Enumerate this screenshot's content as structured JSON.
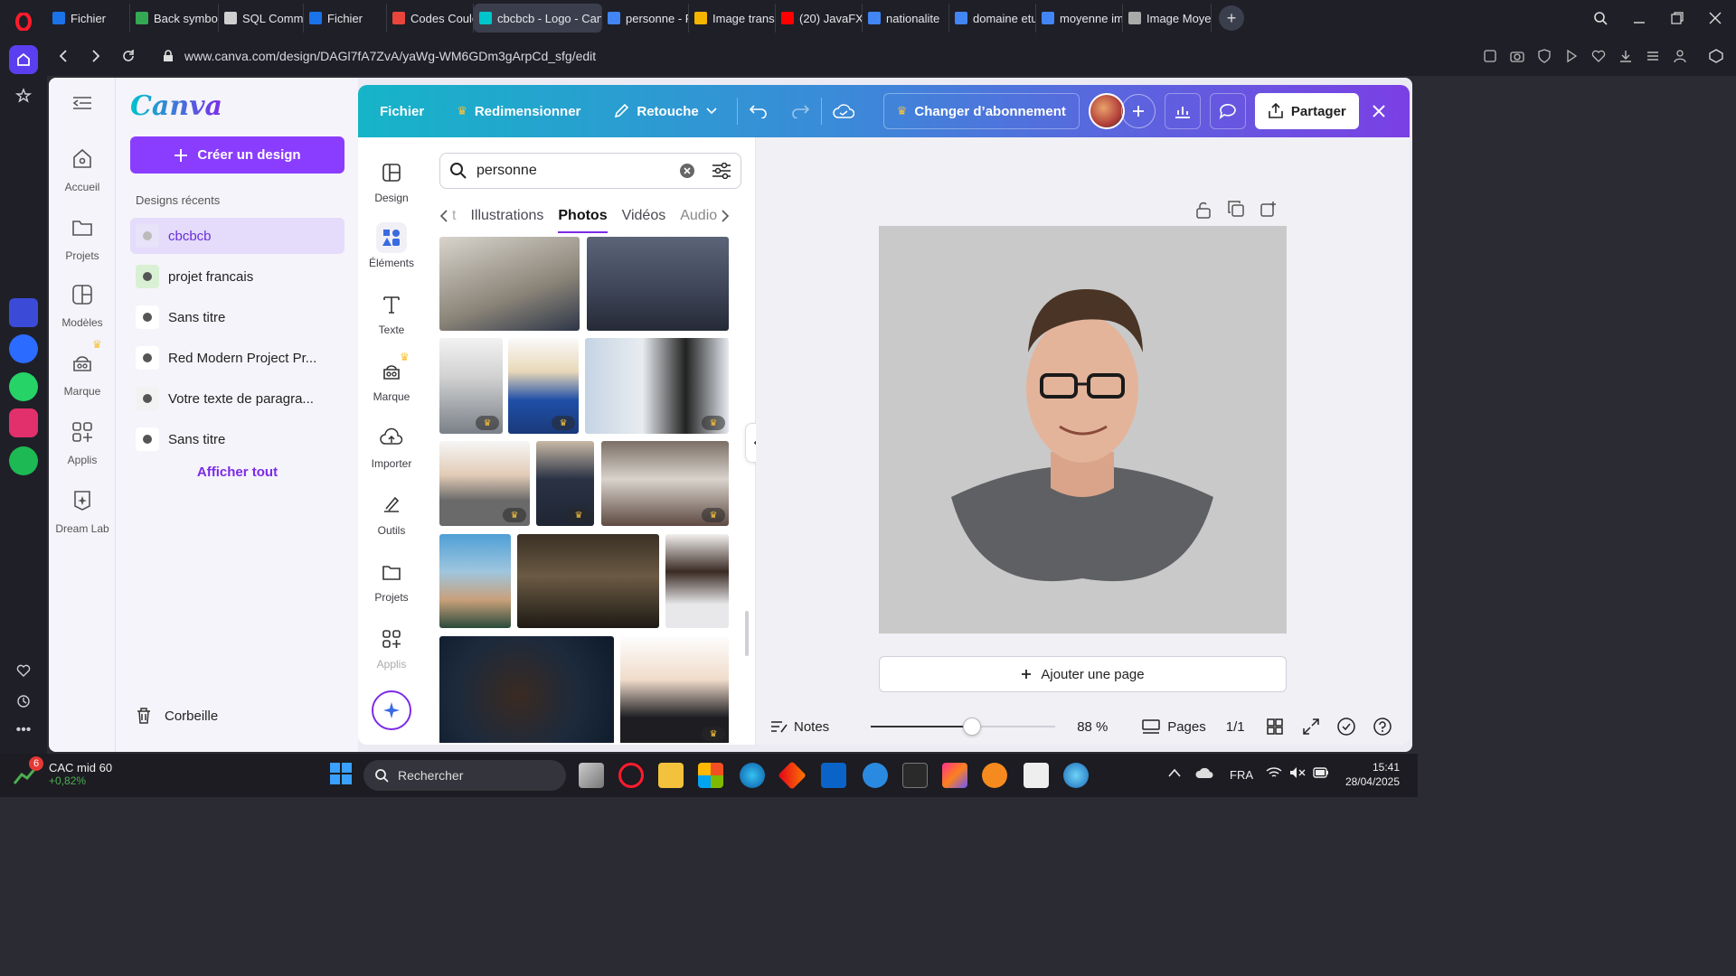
{
  "browser": {
    "tabs": [
      {
        "label": "Fichier",
        "color": "#1a73e8"
      },
      {
        "label": "Back symbo",
        "color": "#34a853"
      },
      {
        "label": "SQL Comma",
        "color": "#cfcfcf"
      },
      {
        "label": "Fichier",
        "color": "#1a73e8"
      },
      {
        "label": "Codes Coule",
        "color": "#e8453c"
      },
      {
        "label": "cbcbcb - Logo - Canv",
        "color": "#00c4cc",
        "active": true
      },
      {
        "label": "personne - F",
        "color": "#4285f4"
      },
      {
        "label": "Image transp",
        "color": "#f4b400"
      },
      {
        "label": "(20) JavaFX",
        "color": "#ff0000"
      },
      {
        "label": "nationalite",
        "color": "#4285f4"
      },
      {
        "label": "domaine etu",
        "color": "#4285f4"
      },
      {
        "label": "moyenne im",
        "color": "#4285f4"
      },
      {
        "label": "Image Moye",
        "color": "#aaaaaa"
      }
    ],
    "url": "www.canva.com/design/DAGl7fA7ZvA/yaWg-WM6GDm3gArpCd_sfg/edit"
  },
  "canva": {
    "rail": [
      {
        "label": "Accueil",
        "icon": "home-icon"
      },
      {
        "label": "Projets",
        "icon": "folder-icon"
      },
      {
        "label": "Modèles",
        "icon": "template-icon"
      },
      {
        "label": "Marque",
        "icon": "brand-icon"
      },
      {
        "label": "Applis",
        "icon": "apps-icon"
      },
      {
        "label": "Dream Lab",
        "icon": "dreamlab-icon"
      }
    ],
    "logo": "Canva",
    "create_label": "Créer un design",
    "recent_title": "Designs récents",
    "recent": [
      {
        "label": "cbcbcb"
      },
      {
        "label": "projet francais"
      },
      {
        "label": "Sans titre"
      },
      {
        "label": "Red Modern Project Pr..."
      },
      {
        "label": "Votre texte de paragra..."
      },
      {
        "label": "Sans titre"
      }
    ],
    "see_all": "Afficher tout",
    "trash": "Corbeille"
  },
  "editor": {
    "topbar": {
      "file": "Fichier",
      "resize": "Redimensionner",
      "retouch": "Retouche",
      "upgrade": "Changer d’abonnement",
      "share": "Partager"
    },
    "obj_rail": [
      {
        "label": "Design"
      },
      {
        "label": "Éléments"
      },
      {
        "label": "Texte"
      },
      {
        "label": "Marque"
      },
      {
        "label": "Importer"
      },
      {
        "label": "Outils"
      },
      {
        "label": "Projets"
      },
      {
        "label": "Applis"
      }
    ],
    "search_value": "personne",
    "tabs": [
      "t",
      "Illustrations",
      "Photos",
      "Vidéos",
      "Audio"
    ],
    "active_tab": "Photos",
    "add_page": "Ajouter une page",
    "notes": "Notes",
    "zoom": "88 %",
    "zoom_fraction": 0.55,
    "pages_label": "Pages",
    "pages_count": "1/1"
  },
  "taskbar": {
    "stock_name": "CAC mid 60",
    "stock_change": "+0,82%",
    "stock_badge": "6",
    "search": "Rechercher",
    "lang": "FRA",
    "time": "15:41",
    "date": "28/04/2025"
  }
}
